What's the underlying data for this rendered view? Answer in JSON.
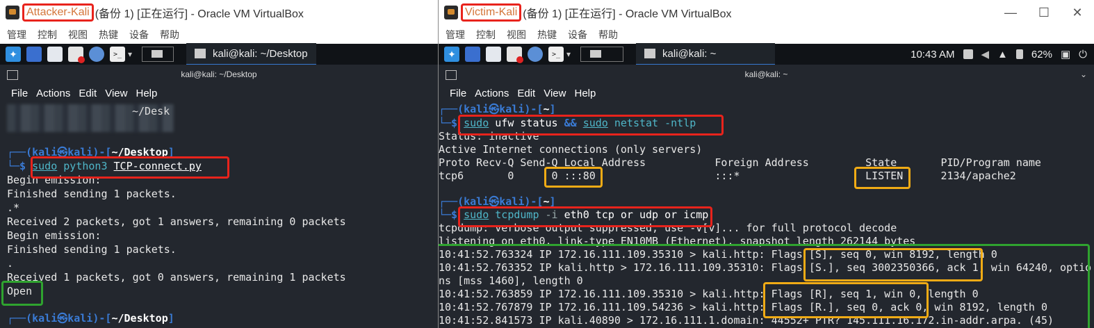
{
  "left": {
    "vm_name": "Attacker-Kali",
    "vm_title_rest": " (备份 1) [正在运行] - Oracle VM VirtualBox",
    "menu": [
      "管理",
      "控制",
      "视图",
      "热键",
      "设备",
      "帮助"
    ],
    "task_title": "kali@kali: ~/Desktop",
    "term_title": "kali@kali: ~/Desktop",
    "term_menu": [
      "File",
      "Actions",
      "Edit",
      "View",
      "Help"
    ],
    "lines": {
      "blurred_fragment": "~/Desk",
      "p1_user": "kali㉿kali",
      "p1_path": "~/Desktop",
      "cmd_sudo": "sudo",
      "cmd_rest": " python3 ",
      "cmd_file": "TCP-connect.py",
      "l1": "Begin emission:",
      "l2": "Finished sending 1 packets.",
      "l3": ".*",
      "l4": "Received 2 packets, got 1 answers, remaining 0 packets",
      "l5": "Begin emission:",
      "l6": "Finished sending 1 packets.",
      "l7": ".",
      "l8": "Received 1 packets, got 0 answers, remaining 1 packets",
      "l9": "Open",
      "p2_user": "kali㉿kali",
      "p2_path": "~/Desktop"
    }
  },
  "right": {
    "vm_name": "Victim-Kali",
    "vm_title_rest": "(备份 1) [正在运行] - Oracle VM VirtualBox",
    "menu": [
      "管理",
      "控制",
      "视图",
      "热键",
      "设备",
      "帮助"
    ],
    "task_title": "kali@kali: ~",
    "clock": "10:43 AM",
    "battery": "62%",
    "term_title": "kali@kali: ~",
    "term_menu": [
      "File",
      "Actions",
      "Edit",
      "View",
      "Help"
    ],
    "lines": {
      "p1_user": "kali㉿kali",
      "p1_path": "~",
      "c1_sudo": "sudo",
      "c1_a": " ufw status ",
      "c1_amp": "&&",
      "c1_sudo2": "sudo",
      "c1_b": " netstat -ntlp",
      "o1": "Status: inactive",
      "o2": "Active Internet connections (only servers)",
      "o3": "Proto Recv-Q Send-Q Local Address           Foreign Address         State       PID/Program name",
      "o4": "tcp6       0      0 :::80                   :::*                    LISTEN      2134/apache2",
      "p2_user": "kali㉿kali",
      "p2_path": "~",
      "c2_sudo": "sudo",
      "c2_a": " tcpdump",
      "c2_b": " -i",
      "c2_c": " eth0 tcp or udp or icmp",
      "t1": "tcpdump: verbose output suppressed, use -v[v]... for full protocol decode",
      "t2": "listening on eth0, link-type EN10MB (Ethernet), snapshot length 262144 bytes",
      "t3": "10:41:52.763324 IP 172.16.111.109.35310 > kali.http: Flags [S], seq 0, win 8192, length 0",
      "t4": "10:41:52.763352 IP kali.http > 172.16.111.109.35310: Flags [S.], seq 3002350366, ack 1, win 64240, optio",
      "t5": "ns [mss 1460], length 0",
      "t6": "10:41:52.763859 IP 172.16.111.109.35310 > kali.http: Flags [R], seq 1, win 0, length 0",
      "t7": "10:41:52.767879 IP 172.16.111.109.54236 > kali.http: Flags [R.], seq 0, ack 0, win 8192, length 0",
      "t8": "10:41:52.841573 IP kali.40890 > 172.16.111.1.domain: 44552+ PTR? 145.111.16.172.in-addr.arpa. (45)"
    }
  },
  "colors": {
    "red_box": "#e8231c",
    "yellow_box": "#f0ab15",
    "green_box": "#2fa32f",
    "prompt_blue": "#3a7bd5"
  }
}
